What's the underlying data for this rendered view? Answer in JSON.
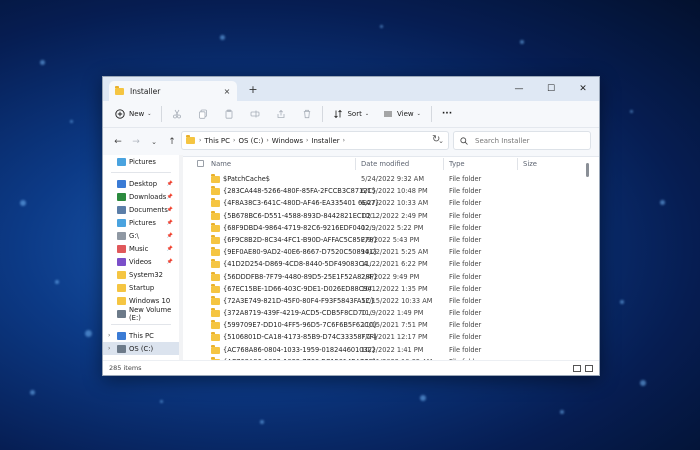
{
  "window": {
    "tab_title": "Installer",
    "tab_close": "×",
    "new_tab": "+",
    "minimize": "—",
    "maximize": "☐",
    "close": "✕"
  },
  "commandbar": {
    "new_label": "New",
    "sort_label": "Sort",
    "view_label": "View",
    "more_label": "···"
  },
  "address": {
    "back": "←",
    "forward": "→",
    "recent": "⌄",
    "up": "↑",
    "crumbs": [
      "This PC",
      "OS (C:)",
      "Windows",
      "Installer"
    ],
    "search_placeholder": "Search Installer"
  },
  "sidebar": {
    "items_top": [
      {
        "label": "Pictures",
        "color": "#4aa3df"
      }
    ],
    "items_pinned": [
      {
        "label": "Desktop",
        "color": "#3a7bd5"
      },
      {
        "label": "Downloads",
        "color": "#2b8a3e"
      },
      {
        "label": "Documents",
        "color": "#5b7ea8"
      },
      {
        "label": "Pictures",
        "color": "#4aa3df"
      },
      {
        "label": "G:\\",
        "color": "#8f98a3"
      },
      {
        "label": "Music",
        "color": "#e0585b"
      },
      {
        "label": "Videos",
        "color": "#7b4fc9"
      },
      {
        "label": "System32",
        "color": "#f5c542"
      },
      {
        "label": "Startup",
        "color": "#f5c542"
      },
      {
        "label": "Windows 10",
        "color": "#f5c542"
      },
      {
        "label": "New Volume (E:)",
        "color": "#6c7a89"
      }
    ],
    "items_bottom": [
      {
        "label": "This PC",
        "color": "#3a7bd5"
      },
      {
        "label": "OS (C:)",
        "color": "#6c7a89"
      }
    ]
  },
  "list": {
    "headers": {
      "name": "Name",
      "date": "Date modified",
      "type": "Type",
      "size": "Size"
    },
    "rows": [
      {
        "name": "$PatchCache$",
        "date": "5/24/2022 9:32 AM",
        "type": "File folder"
      },
      {
        "name": "{283CA448-5266-480F-85FA-2FCCB3C8712C}",
        "date": "6/15/2022 10:48 PM",
        "type": "File folder"
      },
      {
        "name": "{4F8A38C3-641C-480D-AF46-EA335401 6EA7}",
        "date": "6/27/2022 10:33 AM",
        "type": "File folder"
      },
      {
        "name": "{5B678BC6-D551-4588-893D-8442821ECD2...",
        "date": "10/12/2022 2:49 PM",
        "type": "File folder"
      },
      {
        "name": "{68F9DBD4-9864-4719-82C6-9216EDF0402...",
        "date": "12/9/2022 5:22 PM",
        "type": "File folder"
      },
      {
        "name": "{6F9C8B2D-8C34-4FC1-B90D-AFFAC5C85E78}",
        "date": "2/9/2022 5:43 PM",
        "type": "File folder"
      },
      {
        "name": "{9EF0AE80-9AD2-40E6-8667-D7520C508941}",
        "date": "10/22/2021 5:25 AM",
        "type": "File folder"
      },
      {
        "name": "{41D2D254-D869-4CD8-8440-5DF49083C4...",
        "date": "11/22/2021 6:22 PM",
        "type": "File folder"
      },
      {
        "name": "{56DDDFB8-7F79-4480-89D5-25E1F52A828F}",
        "date": "2/4/2022 9:49 PM",
        "type": "File folder"
      },
      {
        "name": "{67EC15BE-1D66-403C-9DE1-D026ED88C94...",
        "date": "10/12/2022 1:35 PM",
        "type": "File folder"
      },
      {
        "name": "{72A3E749-821D-45F0-80F4-F93F5843FA5C}",
        "date": "12/15/2022 10:33 AM",
        "type": "File folder"
      },
      {
        "name": "{372A8719-439F-4219-ACD5-CDB5F8CD70...",
        "date": "11/9/2022 1:49 PM",
        "type": "File folder"
      },
      {
        "name": "{599709E7-DD10-4FF5-96D5-7C6F6B5F62C0}",
        "date": "11/15/2021 7:51 PM",
        "type": "File folder"
      },
      {
        "name": "{5106801D-CA18-4173-85B9-D74C33358F7F}",
        "date": "7/24/2021 12:17 PM",
        "type": "File folder"
      },
      {
        "name": "{AC768A86-0804-1033-1959-018244601032}",
        "date": "10/2/2022 1:41 PM",
        "type": "File folder"
      },
      {
        "name": "{AC768A86-1033-1033-7760-BC15014EA700}",
        "date": "11/21/2022 10:35 AM",
        "type": "File folder"
      }
    ]
  },
  "status": {
    "item_count": "285 items"
  }
}
